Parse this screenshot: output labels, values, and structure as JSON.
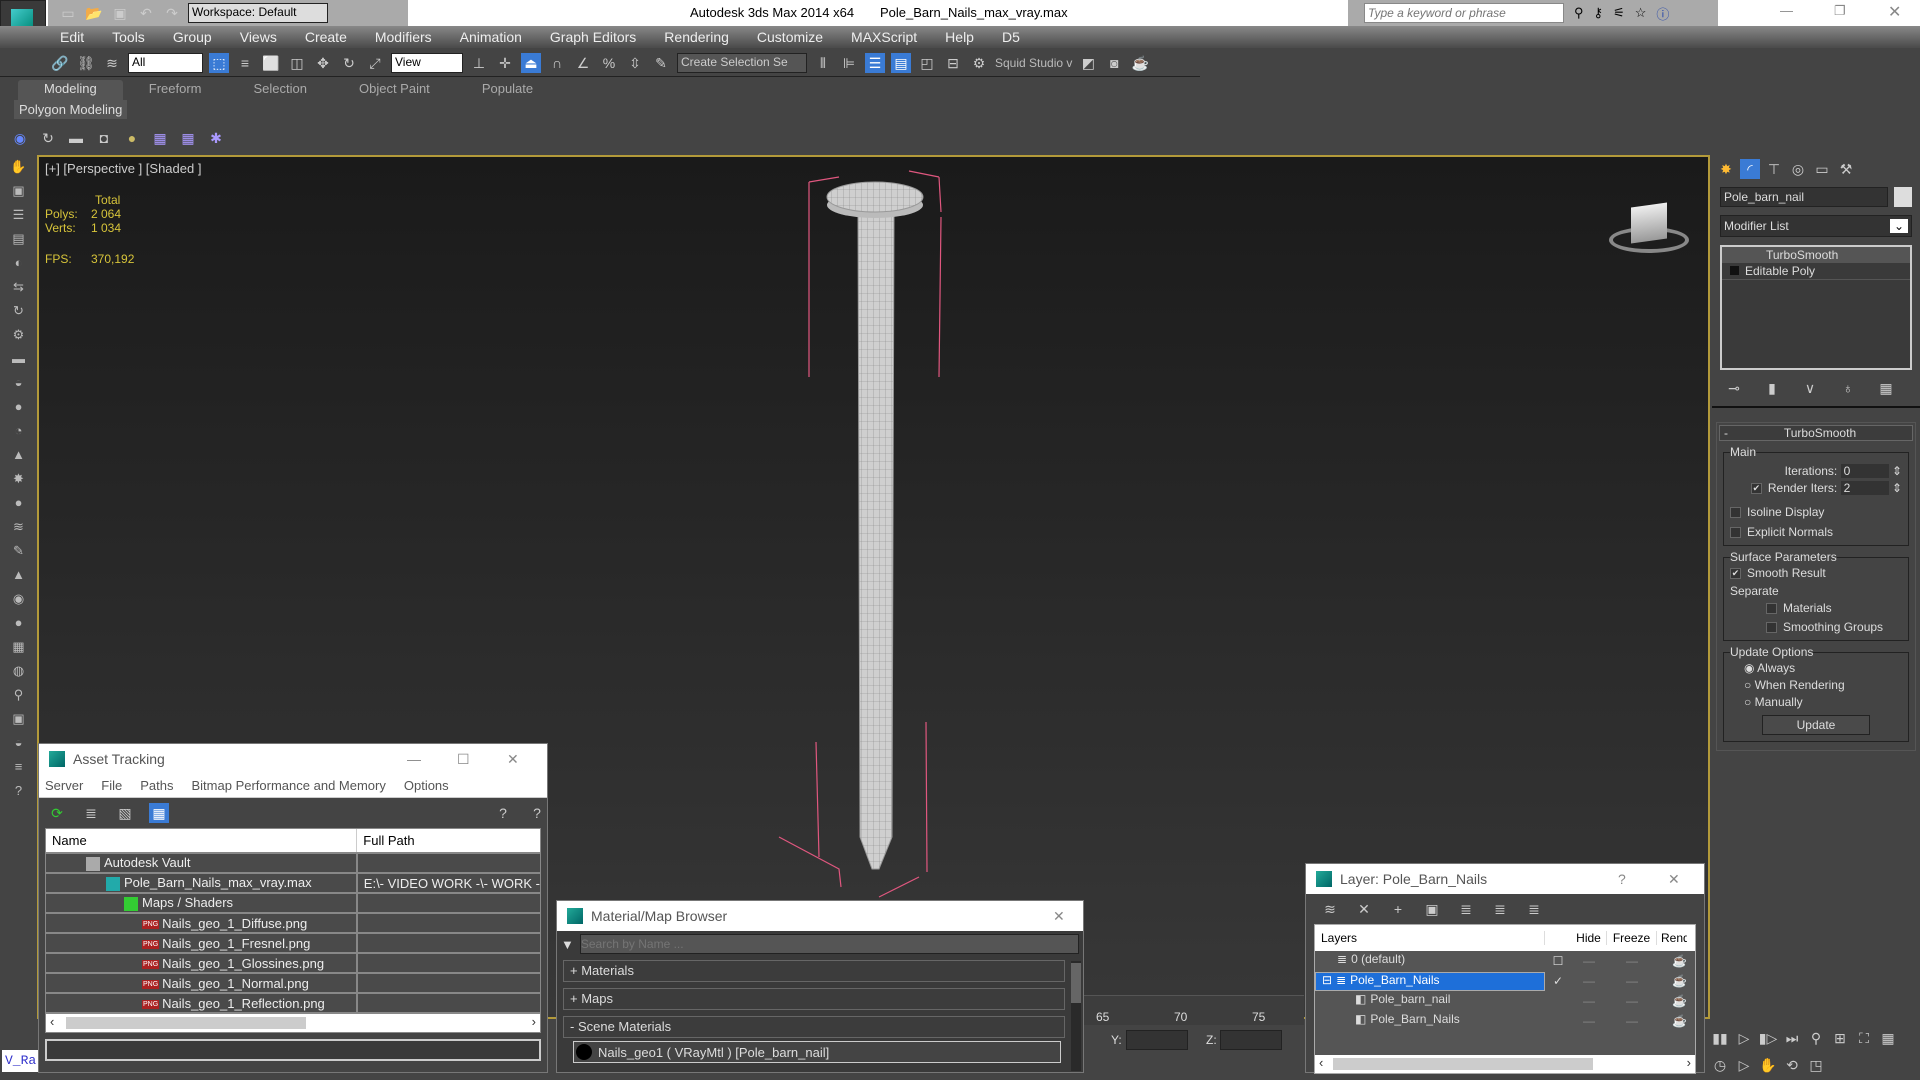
{
  "titlebar": {
    "workspace": "Workspace: Default",
    "app": "Autodesk 3ds Max  2014 x64",
    "file": "Pole_Barn_Nails_max_vray.max",
    "search_placeholder": "Type a keyword or phrase"
  },
  "menu": [
    "Edit",
    "Tools",
    "Group",
    "Views",
    "Create",
    "Modifiers",
    "Animation",
    "Graph Editors",
    "Rendering",
    "Customize",
    "MAXScript",
    "Help",
    "D5"
  ],
  "toolbar": {
    "filter": "All",
    "refcoord": "View",
    "selection_set": "Create Selection Se",
    "squid": "Squid Studio v"
  },
  "ribbon": {
    "tabs": [
      "Modeling",
      "Freeform",
      "Selection",
      "Object Paint",
      "Populate"
    ],
    "active": "Modeling",
    "panel": "Polygon Modeling"
  },
  "viewport": {
    "label": "[+] [Perspective ] [Shaded ]",
    "total": "Total",
    "polys_label": "Polys:",
    "polys": "2 064",
    "verts_label": "Verts:",
    "verts": "1 034",
    "fps_label": "FPS:",
    "fps": "370,192",
    "wire_color": "#e0577f"
  },
  "command_panel": {
    "object_name": "Pole_barn_nail",
    "modifier_list": "Modifier List",
    "stack": [
      "TurboSmooth",
      "Editable Poly"
    ],
    "rollout": "TurboSmooth",
    "main": "Main",
    "iterations_label": "Iterations:",
    "iterations": "0",
    "render_iters_label": "Render Iters:",
    "render_iters": "2",
    "isoline": "Isoline Display",
    "explicit": "Explicit Normals",
    "surface": "Surface Parameters",
    "smooth_result": "Smooth Result",
    "separate": "Separate",
    "materials": "Materials",
    "smoothing_groups": "Smoothing Groups",
    "update_options": "Update Options",
    "always": "Always",
    "when_rendering": "When Rendering",
    "manually": "Manually",
    "update": "Update"
  },
  "asset_tracking": {
    "title": "Asset Tracking",
    "menu": [
      "Server",
      "File",
      "Paths",
      "Bitmap Performance and Memory",
      "Options"
    ],
    "col_name": "Name",
    "col_path": "Full Path",
    "rows": [
      {
        "name": "Autodesk Vault",
        "path": ""
      },
      {
        "name": "Pole_Barn_Nails_max_vray.max",
        "path": "E:\\- VIDEO WORK -\\- WORK -"
      },
      {
        "name": "Maps / Shaders",
        "path": ""
      },
      {
        "name": "Nails_geo_1_Diffuse.png",
        "path": ""
      },
      {
        "name": "Nails_geo_1_Fresnel.png",
        "path": ""
      },
      {
        "name": "Nails_geo_1_Glossines.png",
        "path": ""
      },
      {
        "name": "Nails_geo_1_Normal.png",
        "path": ""
      },
      {
        "name": "Nails_geo_1_Reflection.png",
        "path": ""
      }
    ],
    "png_badge": "PNG"
  },
  "material_browser": {
    "title": "Material/Map Browser",
    "search_placeholder": "Search by Name ...",
    "sections": [
      "+ Materials",
      "+ Maps",
      "- Scene Materials"
    ],
    "item": "Nails_geo1 ( VRayMtl ) [Pole_barn_nail]"
  },
  "layer_dialog": {
    "title": "Layer: Pole_Barn_Nails",
    "help": "?",
    "cols": [
      "Layers",
      "Hide",
      "Freeze",
      "Rend"
    ],
    "rows": [
      "0 (default)",
      "Pole_Barn_Nails",
      "Pole_barn_nail",
      "Pole_Barn_Nails"
    ]
  },
  "timeline": {
    "ticks": [
      "65",
      "70",
      "75"
    ],
    "y_label": "Y:",
    "z_label": "Z:"
  },
  "script_listener": "V_Ra"
}
